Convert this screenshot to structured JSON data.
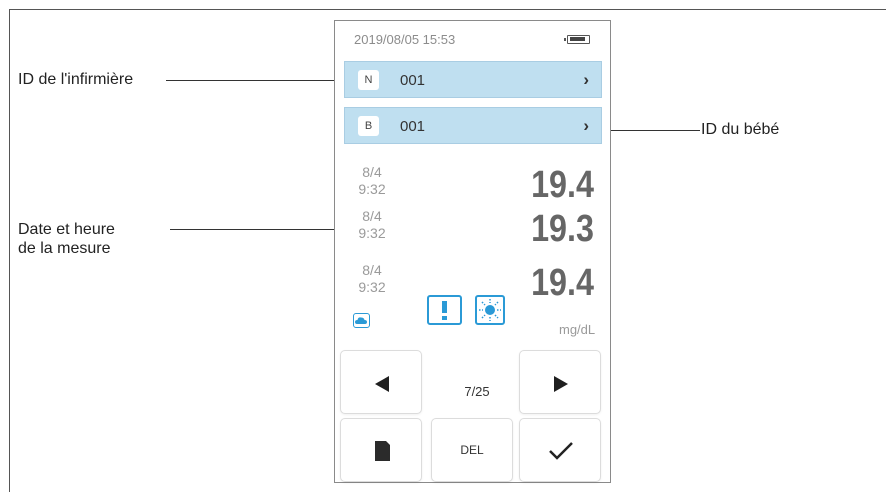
{
  "status_bar": {
    "datetime": "2019/08/05  15:53",
    "battery_icon": "battery-icon"
  },
  "nurse_row": {
    "badge": "N",
    "value": "001"
  },
  "baby_row": {
    "badge": "B",
    "value": "001"
  },
  "readings": [
    {
      "date": "8/4",
      "time": "9:32",
      "value": "19.4"
    },
    {
      "date": "8/4",
      "time": "9:32",
      "value": "19.3"
    },
    {
      "date": "8/4",
      "time": "9:32",
      "value": "19.4"
    }
  ],
  "unit": "mg/dL",
  "icons": [
    "cloud-icon",
    "warning-icon",
    "sun-icon"
  ],
  "pagination": {
    "label": "7/25"
  },
  "buttons": {
    "delete_label": "DEL"
  },
  "callouts": {
    "nurse_id": "ID de l'infirmière",
    "baby_id": "ID du bébé",
    "datetime_line1": "Date et heure",
    "datetime_line2": "de la mesure"
  },
  "colors": {
    "id_row_bg": "#bfdff0",
    "icon_accent": "#2b9ad6"
  }
}
